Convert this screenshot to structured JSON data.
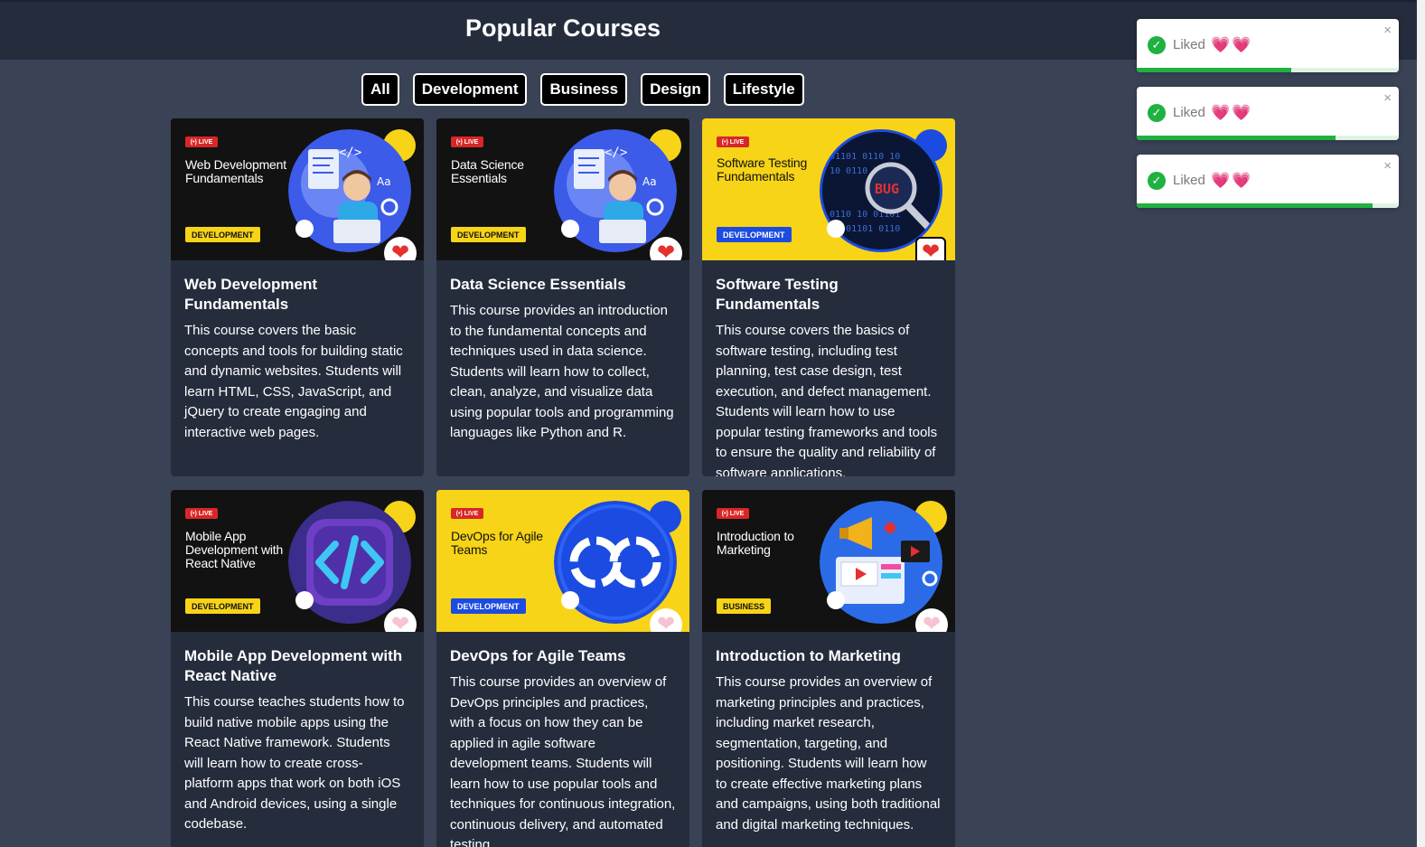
{
  "header": {
    "title": "Popular Courses"
  },
  "filters": [
    "All",
    "Development",
    "Business",
    "Design",
    "Lifestyle"
  ],
  "courses": [
    {
      "thumb_title": "Web Development Fundamentals",
      "live_label": "(•) LIVE",
      "tag": "DEVELOPMENT",
      "title": "Web Development Fundamentals",
      "description": "This course covers the basic concepts and tools for building static and dynamic websites. Students will learn HTML, CSS, JavaScript, and jQuery to create engaging and interactive web pages.",
      "liked": true,
      "theme": "dark",
      "art_icon": "developer-illustration-icon"
    },
    {
      "thumb_title": "Data Science Essentials",
      "live_label": "(•) LIVE",
      "tag": "DEVELOPMENT",
      "title": "Data Science Essentials",
      "description": "This course provides an introduction to the fundamental concepts and techniques used in data science. Students will learn how to collect, clean, analyze, and visualize data using popular tools and programming languages like Python and R.",
      "liked": true,
      "theme": "dark",
      "art_icon": "developer-illustration-icon"
    },
    {
      "thumb_title": "Software Testing Fundamentals",
      "live_label": "(•) LIVE",
      "tag": "DEVELOPMENT",
      "title": "Software Testing Fundamentals",
      "description": "This course covers the basics of software testing, including test planning, test case design, test execution, and defect management. Students will learn how to use popular testing frameworks and tools to ensure the quality and reliability of software applications.",
      "liked": true,
      "theme": "yellow",
      "art_icon": "bug-magnifier-icon",
      "art_text": "BUG"
    },
    {
      "thumb_title": "Mobile App Development with React Native",
      "live_label": "(•) LIVE",
      "tag": "DEVELOPMENT",
      "title": "Mobile App Development with React Native",
      "description": "This course teaches students how to build native mobile apps using the React Native framework. Students will learn how to create cross-platform apps that work on both iOS and Android devices, using a single codebase.",
      "liked": false,
      "theme": "dark",
      "art_icon": "code-brackets-icon"
    },
    {
      "thumb_title": "DevOps for Agile Teams",
      "live_label": "(•) LIVE",
      "tag": "DEVELOPMENT",
      "title": "DevOps for Agile Teams",
      "description": "This course provides an overview of DevOps principles and practices, with a focus on how they can be applied in agile software development teams. Students will learn how to use popular tools and techniques for continuous integration, continuous delivery, and automated testing.",
      "liked": false,
      "theme": "yellow",
      "art_icon": "infinity-loop-icon"
    },
    {
      "thumb_title": "Introduction to Marketing",
      "live_label": "(•) LIVE",
      "tag": "BUSINESS",
      "title": "Introduction to Marketing",
      "description": "This course provides an overview of marketing principles and practices, including market research, segmentation, targeting, and positioning. Students will learn how to create effective marketing plans and campaigns, using both traditional and digital marketing techniques.",
      "liked": false,
      "theme": "dark",
      "art_icon": "megaphone-marketing-icon"
    }
  ],
  "toasts": [
    {
      "text": "Liked",
      "hearts": "💗💗",
      "progress": 0.59
    },
    {
      "text": "Liked",
      "hearts": "💗💗",
      "progress": 0.76
    },
    {
      "text": "Liked",
      "hearts": "💗💗",
      "progress": 0.9
    }
  ],
  "toast_close": "×",
  "toast_check": "✓",
  "heart_glyph": "❤",
  "colors": {
    "background": "#3a4256",
    "header": "#252d3d",
    "card": "#252d3d",
    "accent_yellow": "#f7d417",
    "accent_blue": "#1b4be0",
    "liked_red": "#e53030",
    "unliked_pink": "#f5c3d2",
    "toast_green": "#1fb141"
  }
}
